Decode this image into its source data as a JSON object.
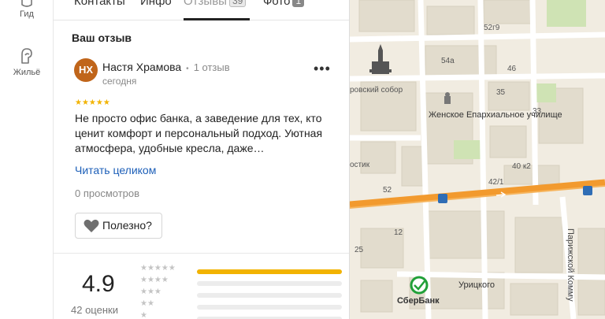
{
  "rail": {
    "items": [
      {
        "label": "Гид",
        "icon": "guide-icon"
      },
      {
        "label": "Жильё",
        "icon": "housing-icon"
      }
    ]
  },
  "tabs": [
    {
      "label": "Контакты"
    },
    {
      "label": "Инфо"
    },
    {
      "label": "Отзывы",
      "count": "39"
    },
    {
      "label": "Фото",
      "count": "1"
    }
  ],
  "review": {
    "section_title": "Ваш отзыв",
    "avatar_initials": "НХ",
    "author": "Настя Храмова",
    "reviews_count": "1 отзыв",
    "date": "сегодня",
    "stars": 5,
    "stars_text": "★★★★★",
    "more_label": "•••",
    "text": "Не просто офис банка, а заведение для тех, кто ценит комфорт и персональный подход. Уютная атмосфера, удобные кресла, даже…",
    "read_more": "Читать целиком",
    "views": "0 просмотров",
    "useful_label": "Полезно?"
  },
  "rating": {
    "value": "4.9",
    "count": "42 оценки",
    "distribution": [
      {
        "stars": "★★★★★",
        "fraction": 1.0
      },
      {
        "stars": "★★★★",
        "fraction": 0.0
      },
      {
        "stars": "★★★",
        "fraction": 0.0
      },
      {
        "stars": "★★",
        "fraction": 0.0
      },
      {
        "stars": "★",
        "fraction": 0.0
      }
    ]
  },
  "map": {
    "labels": {
      "sobor": "ровский собор",
      "eparchy": "Женское Епархиальное училище",
      "kostik": "остик",
      "uritskogo": "Урицкого",
      "sberbank": "СберБанк",
      "parizhskoy": "Парижской Комму",
      "n54a": "54а",
      "n46": "46",
      "n52g9": "52г9",
      "n35": "35",
      "n33": "33",
      "n40k2": "40 к2",
      "n42_1": "42/1",
      "n52": "52",
      "n12": "12",
      "n25": "25"
    },
    "colors": {
      "road": "#f29a2e",
      "ground": "#f1ece1",
      "building": "#e2dccd",
      "green": "#cfe3b4"
    }
  }
}
